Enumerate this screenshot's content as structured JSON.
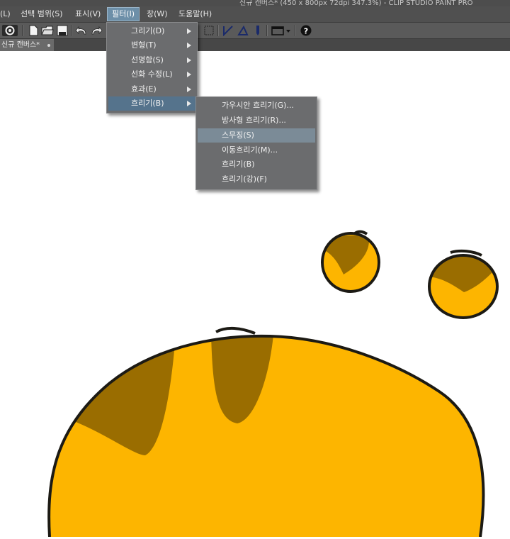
{
  "window": {
    "title": "신규 캔버스* (450 x 800px 72dpi 347.3%)  - CLIP STUDIO PAINT PRO"
  },
  "menubar": {
    "items": [
      {
        "label": "(L)"
      },
      {
        "label": "선택 범위(S)"
      },
      {
        "label": "표시(V)"
      },
      {
        "label": "필터(I)",
        "active": true
      },
      {
        "label": "창(W)"
      },
      {
        "label": "도움말(H)"
      }
    ]
  },
  "toolbar": {
    "icons": [
      "clip-studio-logo-icon",
      "new-file-icon",
      "open-file-icon",
      "save-icon",
      "undo-icon",
      "redo-icon",
      "selection-icon",
      "ruler-icon",
      "snap-ruler-icon",
      "pen-icon",
      "display-mode-icon",
      "help-icon"
    ]
  },
  "tab": {
    "label": "신규 캔버스*"
  },
  "filter_menu": {
    "items": [
      {
        "label": "그리기(D)",
        "has_submenu": true
      },
      {
        "label": "변형(T)",
        "has_submenu": true
      },
      {
        "label": "선명함(S)",
        "has_submenu": true
      },
      {
        "label": "선화 수정(L)",
        "has_submenu": true
      },
      {
        "label": "효과(E)",
        "has_submenu": true
      },
      {
        "label": "흐리기(B)",
        "has_submenu": true,
        "highlighted": true
      }
    ]
  },
  "blur_submenu": {
    "items": [
      {
        "label": "가우시안 흐리기(G)..."
      },
      {
        "label": "방사형 흐리기(R)..."
      },
      {
        "label": "스무징(S)",
        "highlighted": true
      },
      {
        "label": "이동흐리기(M)..."
      },
      {
        "label": "흐리기(B)"
      },
      {
        "label": "흐리기(강)(F)"
      }
    ]
  },
  "colors": {
    "fill_yellow": "#fdb500",
    "stripe_brown": "#9a6d00",
    "outline": "#1c1a14",
    "menu_bg": "#6b6c6e",
    "highlight": "#55738c"
  }
}
